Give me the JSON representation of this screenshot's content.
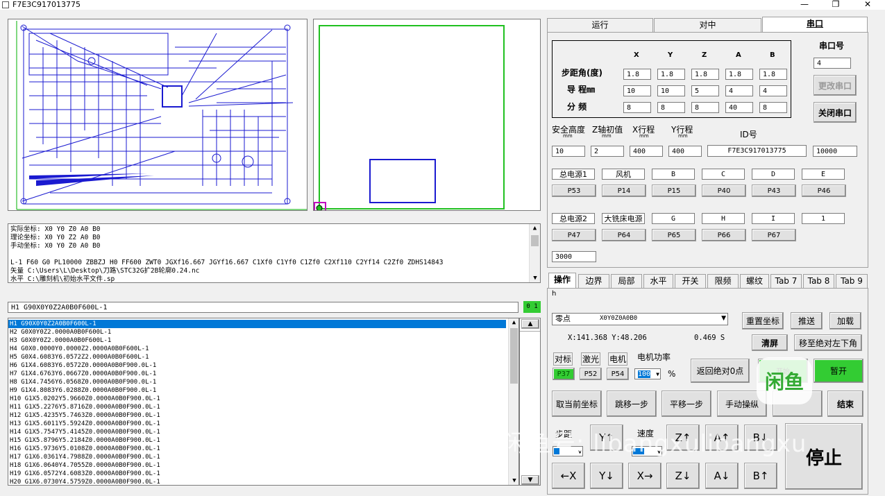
{
  "window": {
    "title": "F7E3C917013775",
    "minimize": "—",
    "maximize": "❐",
    "close": "✕"
  },
  "log": {
    "lines": [
      "实际坐标:  X0 Y0 Z0 A0 B0",
      "理论坐标:  X0 Y0 Z2 A0 B0",
      "手动坐标:  X0 Y0 Z0 A0 B0",
      "",
      "L-1 F60 G0 PL10000 ZBBZJ H0 FF600 ZWT0 JGXf16.667 JGYf16.667 C1Xf0 C1Yf0 C1Zf0 C2Xf110 C2Yf14 C2Zf0 ZDHS14843",
      "矢量 C:\\Users\\L\\Desktop\\刀路\\STC32G扩2B轮廓0.24.nc",
      "水平 C:\\雕刻机\\初始水平文件.sp"
    ]
  },
  "command": {
    "value": "H1 G90X0Y0Z2A0B0F600L-1",
    "status": "0 1"
  },
  "gcode": [
    "H1 G90X0Y0Z2A0B0F600L-1",
    "H2 G0X0Y0Z2.0000A0B0F600L-1",
    "H3 G0X0Y0Z2.0000A0B0F600L-1",
    "H4 G0X0.0000Y0.0000Z2.0000A0B0F600L-1",
    "H5 G0X4.6083Y6.0572Z2.0000A0B0F600L-1",
    "H6 G1X4.6083Y6.0572Z0.0000A0B0F900.0L-1",
    "H7 G1X4.6763Y6.0667Z0.0000A0B0F900.0L-1",
    "H8 G1X4.7456Y6.0568Z0.0000A0B0F900.0L-1",
    "H9 G1X4.8083Y6.0288Z0.0000A0B0F900.0L-1",
    "H10 G1X5.0202Y5.9660Z0.0000A0B0F900.0L-1",
    "H11 G1X5.2276Y5.8716Z0.0000A0B0F900.0L-1",
    "H12 G1X5.4235Y5.7463Z0.0000A0B0F900.0L-1",
    "H13 G1X5.6011Y5.5924Z0.0000A0B0F900.0L-1",
    "H14 G1X5.7547Y5.4145Z0.0000A0B0F900.0L-1",
    "H15 G1X5.8796Y5.2184Z0.0000A0B0F900.0L-1",
    "H16 G1X5.9736Y5.0108Z0.0000A0B0F900.0L-1",
    "H17 G1X6.0361Y4.7988Z0.0000A0B0F900.0L-1",
    "H18 G1X6.0640Y4.7055Z0.0000A0B0F900.0L-1",
    "H19 G1X6.0572Y4.6083Z0.0000A0B0F900.0L-1",
    "H20 G1X6.0730Y4.5759Z0.0000A0B0F900.0L-1"
  ],
  "tabs_top": [
    "运行",
    "对中",
    "串口"
  ],
  "serial": {
    "axes": [
      "X",
      "Y",
      "Z",
      "A",
      "B"
    ],
    "rows": [
      {
        "label": "步距角(度)",
        "values": [
          "1.8",
          "1.8",
          "1.8",
          "1.8",
          "1.8"
        ]
      },
      {
        "label": "导    程㎜",
        "values": [
          "10",
          "10",
          "5",
          "4",
          "4"
        ]
      },
      {
        "label": "分  频",
        "values": [
          "8",
          "8",
          "8",
          "40",
          "8"
        ]
      }
    ],
    "port_label": "串口号",
    "port_value": "4",
    "change_port": "更改串口",
    "close_port": "关闭串口",
    "safe_height": "安全高度",
    "z_init": "Z轴初值",
    "x_travel": "X行程",
    "y_travel": "Y行程",
    "id_label": "ID号",
    "unit": "mm",
    "safe_height_val": "10",
    "z_init_val": "2",
    "x_travel_val": "400",
    "y_travel_val": "400",
    "id_val": "F7E3C917013775",
    "extra_val": "10000",
    "outputs1": [
      "总电源1",
      "风机",
      "B",
      "C",
      "D",
      "E"
    ],
    "ports1": [
      "P53",
      "P14",
      "P15",
      "P40",
      "P43",
      "P46"
    ],
    "outputs2": [
      "总电源2",
      "大铣床电源",
      "G",
      "H",
      "I",
      "1"
    ],
    "ports2": [
      "P47",
      "P64",
      "P65",
      "P66",
      "P67"
    ],
    "delay_val": "3000"
  },
  "tabs_bottom": [
    "操作",
    "边界",
    "局部",
    "水平",
    "开关",
    "限频",
    "螺纹",
    "Tab 7",
    "Tab 8",
    "Tab 9"
  ],
  "op": {
    "h_label": "h",
    "zero_label": "零点",
    "zero_value": "X0Y0Z0A0B0",
    "reset_coord": "重置坐标",
    "push": "推送",
    "load": "加载",
    "xy": "X:141.368    Y:48.206",
    "time": "0.469 S",
    "clear": "清屏",
    "move_abs": "移至绝对左下角",
    "chk1": "对标",
    "chk2": "激光",
    "chk3": "电机",
    "power_label": "电机功率",
    "p1": "P37",
    "p2": "P52",
    "p3": "P54",
    "power_value": "100",
    "percent": "%",
    "return_zero": "返回绝对0点",
    "start": "开始",
    "pause": "暂开",
    "cancel_coord": "取当前坐标",
    "jump": "跳移一步",
    "shift": "平移一步",
    "manual": "手动操纵",
    "end": "结束",
    "step_label": "步距",
    "speed_label": "速度",
    "yup": "Y↑",
    "zup": "Z↑",
    "aup": "A↑",
    "bdown": "B↓",
    "xleft": "←X",
    "ydown": "Y↓",
    "xright": "X→",
    "zdown": "Z↓",
    "adown": "A↓",
    "bup": "B↑",
    "stop": "停止"
  },
  "watermark": "闲鱼号: libangxulibangxu"
}
